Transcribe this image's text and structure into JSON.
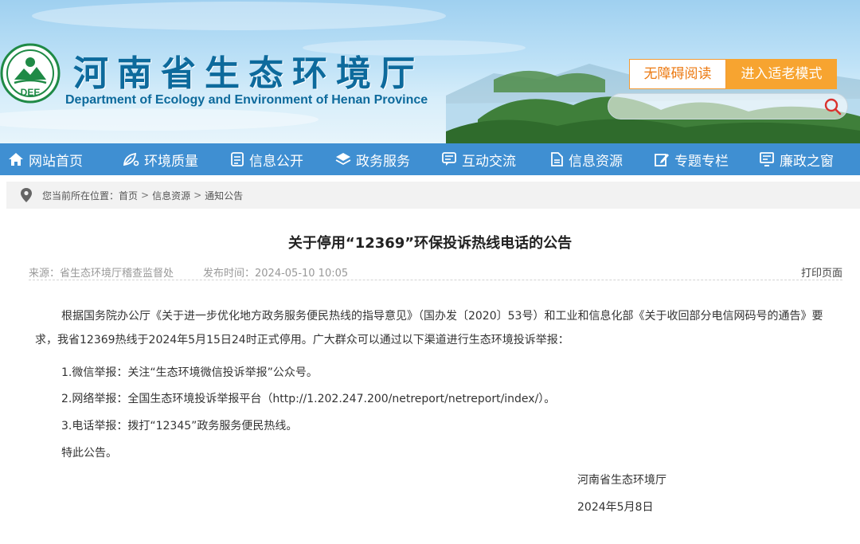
{
  "header": {
    "title": "河南省生态环境厅",
    "subtitle": "Department of Ecology and Environment of Henan Province",
    "emblem_text": "DEE",
    "accessible_button": "无障碍阅读",
    "elder_mode_button": "进入适老模式",
    "search_placeholder": "",
    "colors": {
      "title": "#0d6a9c",
      "accent_orange": "#f7a430",
      "nav_blue": "#3f8fd2"
    }
  },
  "nav": {
    "items": [
      {
        "label": "网站首页",
        "icon": "home-icon"
      },
      {
        "label": "环境质量",
        "icon": "leaf-icon"
      },
      {
        "label": "信息公开",
        "icon": "document-icon"
      },
      {
        "label": "政务服务",
        "icon": "layers-icon"
      },
      {
        "label": "互动交流",
        "icon": "chat-icon"
      },
      {
        "label": "信息资源",
        "icon": "file-icon"
      },
      {
        "label": "专题专栏",
        "icon": "edit-icon"
      },
      {
        "label": "廉政之窗",
        "icon": "monitor-icon"
      }
    ]
  },
  "breadcrumb": {
    "prefix": "您当前所在位置：",
    "items": [
      "首页",
      "信息资源",
      "通知公告"
    ],
    "separator": ">"
  },
  "article": {
    "title": "关于停用“12369”环保投诉热线电话的公告",
    "source": "来源：省生态环境厅稽查监督处",
    "publish_time": "发布时间：2024-05-10 10:05",
    "print_label": "打印页面",
    "intro": "根据国务院办公厅《关于进一步优化地方政务服务便民热线的指导意见》（国办发〔2020〕53号）和工业和信息化部《关于收回部分电信网码号的通告》要求，我省12369热线于2024年5月15日24时正式停用。广大群众可以通过以下渠道进行生态环境投诉举报：",
    "items": [
      "1.微信举报：关注“生态环境微信投诉举报”公众号。",
      "2.网络举报：全国生态环境投诉举报平台（http://1.202.247.200/netreport/netreport/index/）。",
      "3.电话举报：拨打“12345”政务服务便民热线。"
    ],
    "closing": "特此公告。",
    "signature": "河南省生态环境厅",
    "sign_date": "2024年5月8日"
  }
}
